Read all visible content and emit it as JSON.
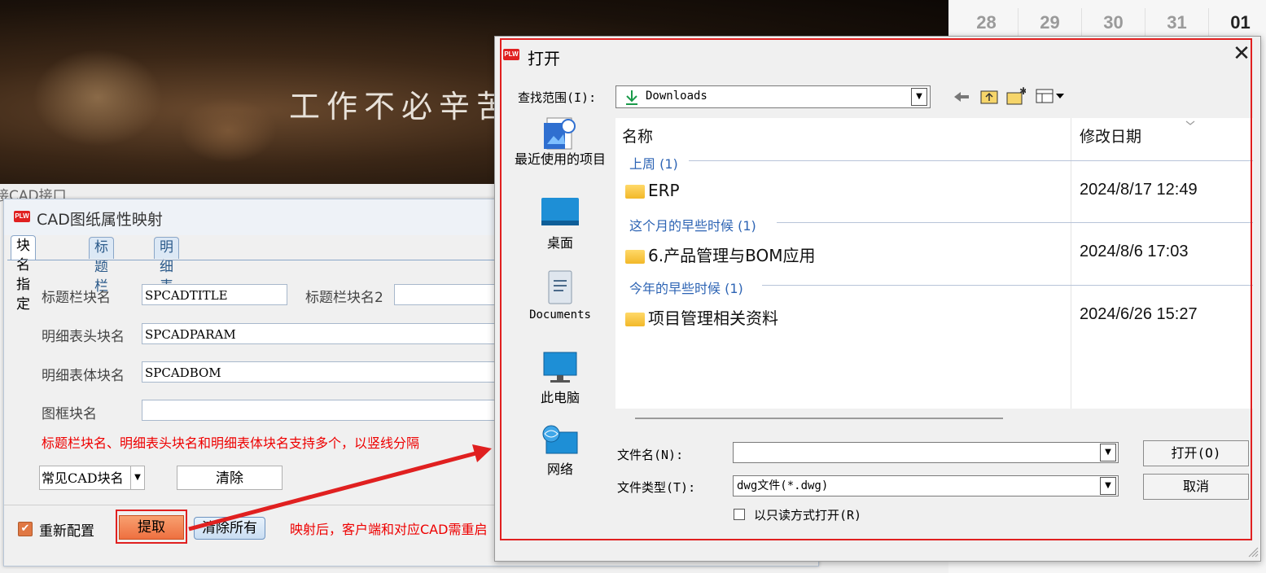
{
  "background": {
    "slogan": "工作不必辛苦",
    "base_window_title": "接CAD接口",
    "calendar_days": [
      "28",
      "29",
      "30",
      "31",
      "01"
    ]
  },
  "cad_dialog": {
    "logo_text": "PLW",
    "title": "CAD图纸属性映射",
    "tabs": [
      "块名指定",
      "标题栏",
      "明细表"
    ],
    "fields": {
      "title_block_label": "标题栏块名",
      "title_block_value": "SPCADTITLE",
      "title_block2_label": "标题栏块名2",
      "title_block2_value": "",
      "detail_header_label": "明细表头块名",
      "detail_header_value": "SPCADPARAM",
      "detail_body_label": "明细表体块名",
      "detail_body_value": "SPCADBOM",
      "frame_label": "图框块名",
      "frame_value": ""
    },
    "note": "标题栏块名、明细表头块名和明细表体块名支持多个，以竖线分隔",
    "common_blocks_select": "常见CAD块名",
    "clear_button": "清除",
    "reconfig_label": "重新配置",
    "extract_button": "提取",
    "clear_all_button": "清除所有",
    "footer_note": "映射后，客户端和对应CAD需重启"
  },
  "open_dialog": {
    "logo_text": "PLW",
    "title": "打开",
    "close_symbol": "✕",
    "look_in_label": "查找范围(I):",
    "look_in_value": "Downloads",
    "places": [
      {
        "label": "最近使用的项目"
      },
      {
        "label": "桌面"
      },
      {
        "label": "Documents"
      },
      {
        "label": "此电脑"
      },
      {
        "label": "网络"
      }
    ],
    "columns": {
      "name": "名称",
      "modified": "修改日期"
    },
    "groups": [
      {
        "header": "上周 (1)",
        "items": [
          {
            "name": "ERP",
            "date": "2024/8/17 12:49"
          }
        ]
      },
      {
        "header": "这个月的早些时候 (1)",
        "items": [
          {
            "name": "6.产品管理与BOM应用",
            "date": "2024/8/6 17:03"
          }
        ]
      },
      {
        "header": "今年的早些时候 (1)",
        "items": [
          {
            "name": "项目管理相关资料",
            "date": "2024/6/26 15:27"
          }
        ]
      }
    ],
    "file_name_label": "文件名(N):",
    "file_name_value": "",
    "file_type_label": "文件类型(T):",
    "file_type_value": "dwg文件(*.dwg)",
    "readonly_label": "以只读方式打开(R)",
    "open_button": "打开(O)",
    "cancel_button": "取消"
  },
  "colors": {
    "annotation_red": "#e02020",
    "group_header_blue": "#2d64b4",
    "extract_button_orange": "#ee7040"
  }
}
